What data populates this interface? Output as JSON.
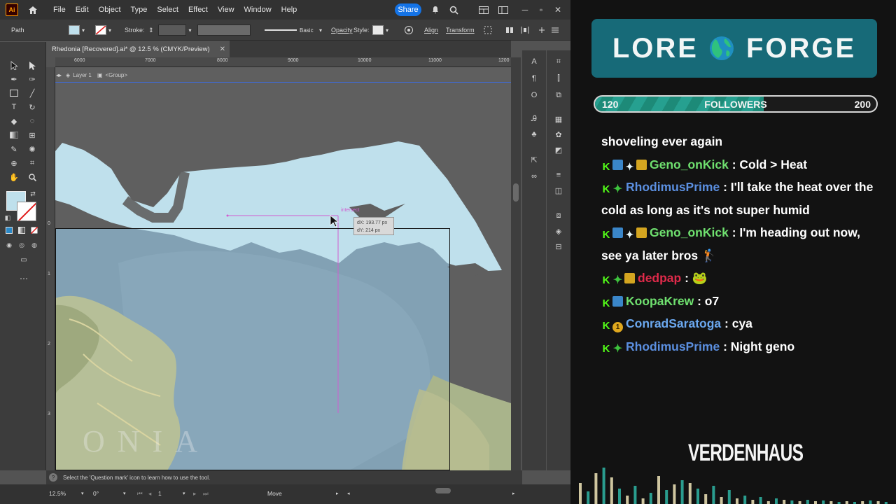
{
  "illustrator": {
    "menu": [
      "File",
      "Edit",
      "Object",
      "Type",
      "Select",
      "Effect",
      "View",
      "Window",
      "Help"
    ],
    "share_label": "Share",
    "control_bar": {
      "selection": "Path",
      "stroke_label": "Stroke:",
      "brush_label": "Basic",
      "opacity_label": "Opacity",
      "style_label": "Style:",
      "align_label": "Align",
      "transform_label": "Transform"
    },
    "document_tab": "Rhedonia [Recovered].ai* @ 12.5 % (CMYK/Preview)",
    "breadcrumb": {
      "layer": "Layer 1",
      "group": "<Group>"
    },
    "ruler_top": [
      "6000",
      "7000",
      "8000",
      "9000",
      "10000",
      "11000",
      "1200"
    ],
    "ruler_left": [
      "0",
      "1",
      "2",
      "3"
    ],
    "smart_guide": {
      "label": "intersect",
      "dx": "dX: 193.77 px",
      "dy": "dY: 214 px"
    },
    "map_watermark": "ONIA",
    "status_hint": "Select the 'Question mark' icon to learn how to use the tool.",
    "bottom_bar": {
      "zoom": "12.5%",
      "rotation": "0°",
      "artboard": "1",
      "tool": "Move"
    }
  },
  "overlay": {
    "brand_left": "LORE",
    "brand_right": "FORGE",
    "followers": {
      "current": "120",
      "label": "FOLLOWERS",
      "goal": "200",
      "progress": 0.6
    },
    "chat": [
      {
        "user": "",
        "badges": [],
        "text": "shoveling ever again",
        "color": ""
      },
      {
        "user": "Geno_onKick",
        "badges": [
          "kick",
          "blue",
          "star",
          "crown"
        ],
        "text": ": Cold > Heat",
        "color": "green"
      },
      {
        "user": "RhodimusPrime",
        "badges": [
          "kick",
          "green"
        ],
        "text": ": I'll take the heat over the cold as long as it's not super humid",
        "color": "blue"
      },
      {
        "user": "Geno_onKick",
        "badges": [
          "kick",
          "blue",
          "star",
          "crown"
        ],
        "text": ": I'm heading out now, see ya later bros 🏌",
        "color": "green"
      },
      {
        "user": "dedpap",
        "badges": [
          "kick",
          "green",
          "crown"
        ],
        "text": ": 🐸",
        "color": "red"
      },
      {
        "user": "KoopaKrew",
        "badges": [
          "kick",
          "blue"
        ],
        "text": ": o7",
        "color": "green"
      },
      {
        "user": "ConradSaratoga",
        "badges": [
          "kick",
          "gold"
        ],
        "text": ": cya",
        "color": "cyan"
      },
      {
        "user": "RhodimusPrime",
        "badges": [
          "kick",
          "green"
        ],
        "text": ": Night geno",
        "color": "blue"
      }
    ],
    "sponsor": "VERDENHAUS",
    "colors": {
      "brand_bg": "#176a78",
      "progress": "#1d8a78",
      "kick": "#53fc18"
    }
  }
}
